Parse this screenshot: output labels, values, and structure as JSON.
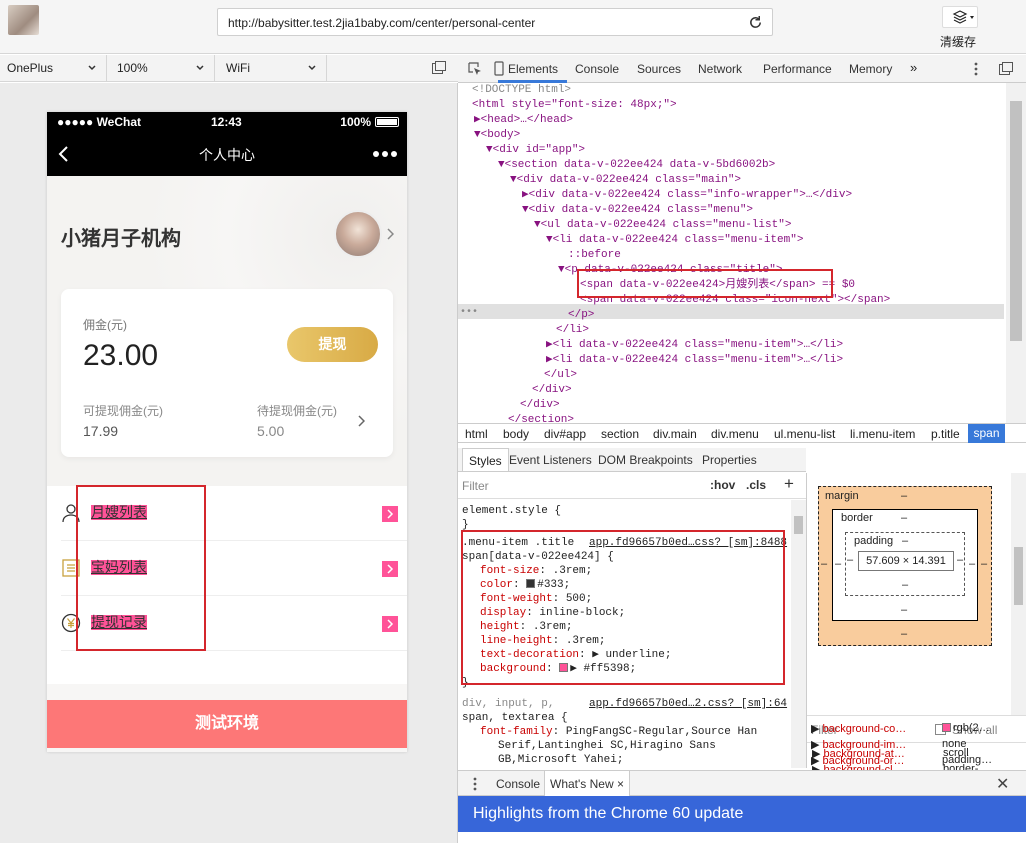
{
  "browser": {
    "url": "http://babysitter.test.2jia1baby.com/center/personal-center",
    "cache_label": "清缓存"
  },
  "device_toolbar": {
    "device": "OnePlus",
    "zoom": "100%",
    "network": "WiFi"
  },
  "phone": {
    "status": {
      "signal": "●●●●● WeChat",
      "time": "12:43",
      "battery": "100%"
    },
    "nav_title": "个人中心",
    "org_name": "小猪月子机构",
    "card": {
      "commission_label": "佣金(元)",
      "commission_value": "23.00",
      "withdraw_label": "提现",
      "available_label": "可提现佣金(元)",
      "available_value": "17.99",
      "pending_label": "待提现佣金(元)",
      "pending_value": "5.00"
    },
    "menu": [
      {
        "title": "月嫂列表",
        "icon": "person-icon"
      },
      {
        "title": "宝妈列表",
        "icon": "list-icon"
      },
      {
        "title": "提现记录",
        "icon": "yen-coin-icon"
      }
    ],
    "bottom_bar": "测试环境"
  },
  "devtools": {
    "tabs": [
      "Elements",
      "Console",
      "Sources",
      "Network",
      "Performance",
      "Memory"
    ],
    "more_tabs": "»",
    "dom_lines": [
      [
        "!DOCTYPE",
        "<!DOCTYPE html>"
      ],
      [
        "html",
        "<html style=\"font-size: 48px;\">"
      ],
      [
        "head",
        "▶<head>…</head>"
      ],
      [
        "body",
        "▼<body>"
      ],
      [
        "div-app",
        "▼<div id=\"app\">"
      ],
      [
        "section",
        "▼<section data-v-022ee424 data-v-5bd6002b>"
      ],
      [
        "div-main",
        "▼<div data-v-022ee424 class=\"main\">"
      ],
      [
        "div-info",
        "▶<div data-v-022ee424 class=\"info-wrapper\">…</div>"
      ],
      [
        "div-menu",
        "▼<div data-v-022ee424 class=\"menu\">"
      ],
      [
        "ul",
        "▼<ul data-v-022ee424 class=\"menu-list\">"
      ],
      [
        "li1",
        "▼<li data-v-022ee424 class=\"menu-item\">"
      ],
      [
        "before",
        "::before"
      ],
      [
        "p",
        "▼<p data-v-022ee424 class=\"title\">"
      ],
      [
        "span-sel",
        "<span data-v-022ee424>月嫂列表</span> == $0"
      ],
      [
        "span-next",
        "<span data-v-022ee424 class=\"icon-next\"></span>"
      ],
      [
        "p-close",
        "</p>"
      ],
      [
        "li-close",
        "</li>"
      ],
      [
        "li2",
        "▶<li data-v-022ee424 class=\"menu-item\">…</li>"
      ],
      [
        "li3",
        "▶<li data-v-022ee424 class=\"menu-item\">…</li>"
      ],
      [
        "ul-close",
        "</ul>"
      ],
      [
        "div-close1",
        "</div>"
      ],
      [
        "div-close2",
        "</div>"
      ],
      [
        "section-close",
        "</section>"
      ]
    ],
    "breadcrumbs": [
      "html",
      "body",
      "div#app",
      "section",
      "div.main",
      "div.menu",
      "ul.menu-list",
      "li.menu-item",
      "p.title",
      "span"
    ],
    "styles_tabs": [
      "Styles",
      "Event Listeners",
      "DOM Breakpoints",
      "Properties"
    ],
    "filter_placeholder": "Filter",
    "hov": ":hov",
    "cls": ".cls",
    "add_rule": "+",
    "styles": {
      "element_style": "element.style {",
      "close": "}",
      "rule1_selector": ".menu-item .title",
      "rule1_source": "app.fd96657b0ed…css? [sm]:8488",
      "rule1_selector2": "span[data-v-022ee424] {",
      "props": [
        {
          "name": "font-size",
          "value": ".3rem;"
        },
        {
          "name": "color",
          "value": "#333;",
          "swatch": "#333333"
        },
        {
          "name": "font-weight",
          "value": "500;"
        },
        {
          "name": "display",
          "value": "inline-block;"
        },
        {
          "name": "height",
          "value": ".3rem;"
        },
        {
          "name": "line-height",
          "value": ".3rem;"
        },
        {
          "name": "text-decoration",
          "value": "▶ underline;"
        },
        {
          "name": "background",
          "value": "▶ #ff5398;",
          "swatch": "#ff5398"
        }
      ],
      "rule2_selector": "div, input, p,",
      "rule2_source": "app.fd96657b0ed…2.css? [sm]:64",
      "rule2_selector2": "span, textarea {",
      "rule2_prop_name": "font-family",
      "rule2_prop_value": "PingFangSC-Regular,Source Han",
      "rule2_prop_value2": "Serif,Lantinghei SC,Hiragino Sans",
      "rule2_prop_value3": "GB,Microsoft Yahei;"
    },
    "box_model": {
      "margin": "margin",
      "border": "border",
      "padding": "padding",
      "dash": "–",
      "content": "57.609 × 14.391"
    },
    "computed_filter": "Filter",
    "show_all": "Show all",
    "computed": [
      {
        "name": "background-at…",
        "value": "scroll"
      },
      {
        "name": "background-cl…",
        "value": "border-…"
      },
      {
        "name": "background-co…",
        "value": "rgb(2…",
        "swatch": "#ff5398"
      },
      {
        "name": "background-im…",
        "value": "none"
      },
      {
        "name": "background-or…",
        "value": "padding…"
      }
    ],
    "drawer": {
      "console": "Console",
      "whats_new": "What's New",
      "close_tab": "×",
      "close": "✕",
      "banner": "Highlights from the Chrome 60 update"
    }
  },
  "colors": {
    "accent_pink": "#ff5398",
    "gold": "#d8aa45",
    "test_bar": "#fd7777",
    "devtools_blue": "#3879d9",
    "highlight_red": "#d4262c"
  }
}
